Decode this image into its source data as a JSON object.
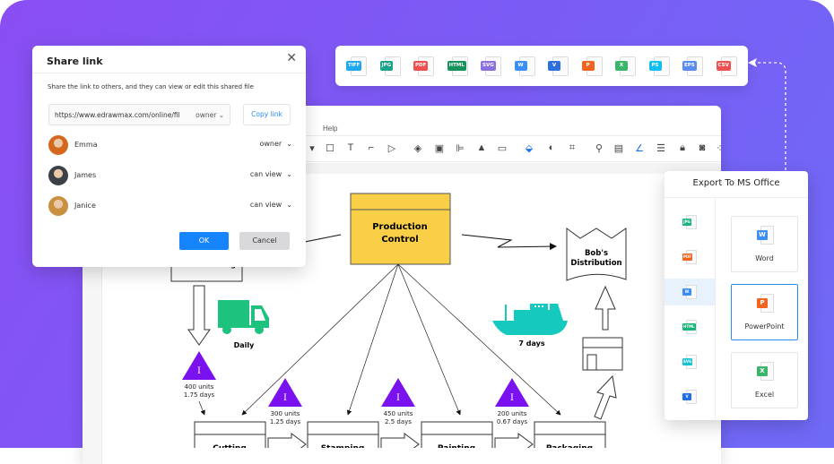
{
  "editor": {
    "menu_help": "Help"
  },
  "share_dialog": {
    "title": "Share link",
    "close_icon": "close-icon",
    "description": "Share the link to others, and they can view or edit this shared file",
    "link_url": "https://www.edrawmax.com/online/fil",
    "link_permission": "owner",
    "copy_link_label": "Copy link",
    "users": [
      {
        "name": "Emma",
        "role": "owner",
        "avatar_color": "#d4691e"
      },
      {
        "name": "James",
        "role": "can view",
        "avatar_color": "#3c4148"
      },
      {
        "name": "Janice",
        "role": "can view",
        "avatar_color": "#c8903f"
      }
    ],
    "ok_label": "OK",
    "cancel_label": "Cancel",
    "chevron": "⌄"
  },
  "formats": [
    {
      "label": "TIFF",
      "color": "#1fa8f0"
    },
    {
      "label": "JPG",
      "color": "#17a389"
    },
    {
      "label": "PDF",
      "color": "#ef4f4f"
    },
    {
      "label": "HTML",
      "color": "#15935a"
    },
    {
      "label": "SVG",
      "color": "#8a6fe0"
    },
    {
      "label": "W",
      "color": "#3a8ef6"
    },
    {
      "label": "V",
      "color": "#2e6fe0"
    },
    {
      "label": "P",
      "color": "#f2641f"
    },
    {
      "label": "X",
      "color": "#3bb56a"
    },
    {
      "label": "PS",
      "color": "#12bff0"
    },
    {
      "label": "EPS",
      "color": "#5b8af0"
    },
    {
      "label": "CSV",
      "color": "#ec5252"
    }
  ],
  "export_panel": {
    "title": "Export To MS Office",
    "side_items": [
      {
        "label": "JPG",
        "color": "#17b57a",
        "selected": false
      },
      {
        "label": "PDF",
        "color": "#f2641f",
        "selected": false
      },
      {
        "label": "W",
        "color": "#3a8ef6",
        "selected": true
      },
      {
        "label": "HTML",
        "color": "#18b378",
        "selected": false
      },
      {
        "label": "SVG",
        "color": "#18c2cf",
        "selected": false
      },
      {
        "label": "V",
        "color": "#1f6fe8",
        "selected": false
      }
    ],
    "cards": [
      {
        "label": "Word",
        "tag": "W",
        "color": "#3a8ef6",
        "selected": false
      },
      {
        "label": "PowerPoint",
        "tag": "P",
        "color": "#f2641f",
        "selected": true
      },
      {
        "label": "Excel",
        "tag": "X",
        "color": "#3bb56a",
        "selected": false
      }
    ]
  },
  "diagram": {
    "production_control": "Production",
    "production_control_2": "Control",
    "distribution_1": "Bob's",
    "distribution_2": "Distribution",
    "supplier_label": "Manufacturing",
    "truck_label": "Daily",
    "ship_label": "7 days",
    "inventories": [
      {
        "units": "400 units",
        "days": "1.75 days"
      },
      {
        "units": "300 units",
        "days": "1.25 days"
      },
      {
        "units": "450 units",
        "days": "2.5 days"
      },
      {
        "units": "200 units",
        "days": "0.67 days"
      }
    ],
    "inventory_symbol": "I",
    "process_labels": [
      "Cutting",
      "Stamping",
      "Painting",
      "Packaging"
    ],
    "colors": {
      "production_fill": "#f8cf47",
      "inventory": "#7a12f0",
      "truck": "#1dc27e",
      "ship": "#16c9bf"
    }
  }
}
